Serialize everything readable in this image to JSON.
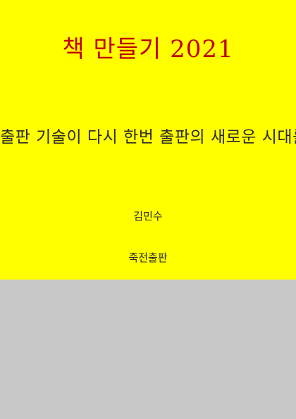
{
  "cover": {
    "title": "책 만들기 2021",
    "subtitle": "출판 기술이 다시 한번 출판의 새로운 시대를 연다",
    "author": "김민수",
    "publisher": "죽전출판"
  },
  "colors": {
    "cover_background": "#ffff00",
    "lower_background": "#c8c8c8",
    "title_color": "#c00000",
    "text_color": "#2a2a2a"
  }
}
